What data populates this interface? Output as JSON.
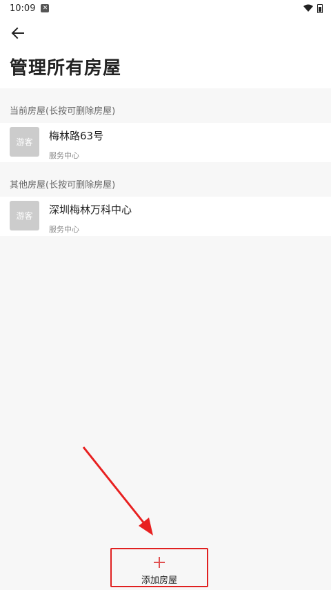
{
  "status_bar": {
    "time": "10:09",
    "notification_icon": "notification-icon",
    "wifi_icon": "wifi-icon",
    "battery_icon": "battery-icon"
  },
  "header": {
    "back_icon": "back-arrow-icon",
    "title": "管理所有房屋"
  },
  "sections": {
    "current": {
      "header": "当前房屋(长按可删除房屋)",
      "items": [
        {
          "avatar": "游客",
          "name": "梅林路63号",
          "sub": "服务中心"
        }
      ]
    },
    "other": {
      "header": "其他房屋(长按可删除房屋)",
      "items": [
        {
          "avatar": "游客",
          "name": "深圳梅林万科中心",
          "sub": "服务中心"
        }
      ]
    }
  },
  "footer": {
    "add_icon": "plus-icon",
    "add_label": "添加房屋"
  },
  "colors": {
    "highlight": "#e02020",
    "annotation_arrow": "#e82020",
    "avatar_bg": "#cccccc",
    "section_bg": "#f7f7f7"
  }
}
